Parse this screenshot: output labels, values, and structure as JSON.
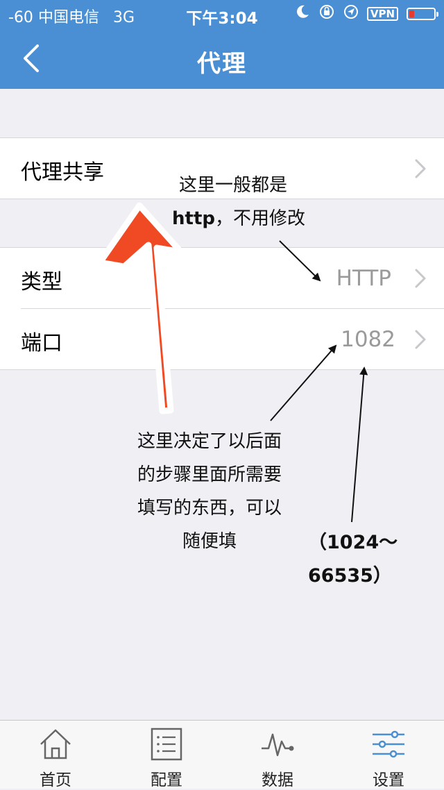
{
  "status_bar": {
    "signal": "-60",
    "carrier": "中国电信",
    "network": "3G",
    "time": "下午3:04",
    "vpn": "VPN",
    "battery_level": 0.2,
    "battery_color": "#e53b2f"
  },
  "nav": {
    "title": "代理",
    "back_icon": "chevron-left-icon"
  },
  "colors": {
    "header_bg": "#4a8fd3",
    "page_bg": "#efeff4",
    "arrow_red": "#f04a24"
  },
  "rows": {
    "proxy_share": {
      "label": "代理共享"
    },
    "type": {
      "label": "类型",
      "value": "HTTP"
    },
    "port": {
      "label": "端口",
      "value": "1082"
    }
  },
  "annotations": {
    "type_note_line1": "这里一般都是",
    "type_note_line2_bold": "http",
    "type_note_line2_rest": "，不用修改",
    "share_note_line1": "这里决定了以后面",
    "share_note_line2": "的步骤里面所需要",
    "share_note_line3": "填写的东西，可以",
    "share_note_line4": "随便填",
    "port_note_line1": "（1024～",
    "port_note_line2": "66535）"
  },
  "tabs": [
    {
      "label": "首页",
      "icon": "home-icon"
    },
    {
      "label": "配置",
      "icon": "list-icon"
    },
    {
      "label": "数据",
      "icon": "pulse-chart-icon"
    },
    {
      "label": "设置",
      "icon": "sliders-icon",
      "active": true
    }
  ]
}
